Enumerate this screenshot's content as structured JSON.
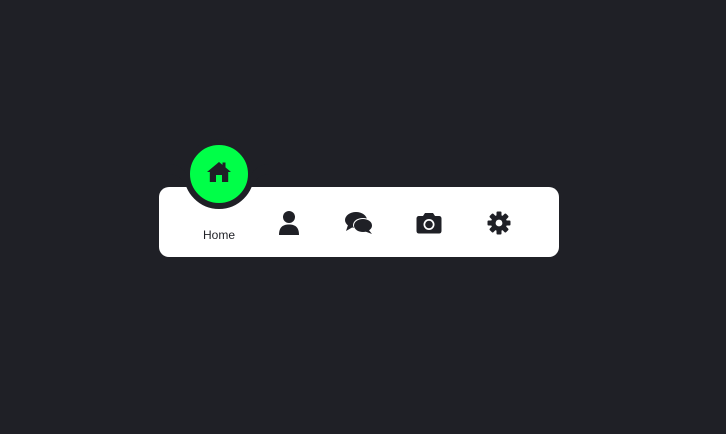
{
  "colors": {
    "background": "#1f2026",
    "navbar": "#ffffff",
    "accent": "#00ff48",
    "icon": "#1f2026"
  },
  "navigation": {
    "active_index": 0,
    "items": [
      {
        "label": "Home",
        "icon": "home-icon"
      },
      {
        "label": "",
        "icon": "user-icon"
      },
      {
        "label": "",
        "icon": "comments-icon"
      },
      {
        "label": "",
        "icon": "camera-icon"
      },
      {
        "label": "",
        "icon": "gear-icon"
      }
    ]
  }
}
